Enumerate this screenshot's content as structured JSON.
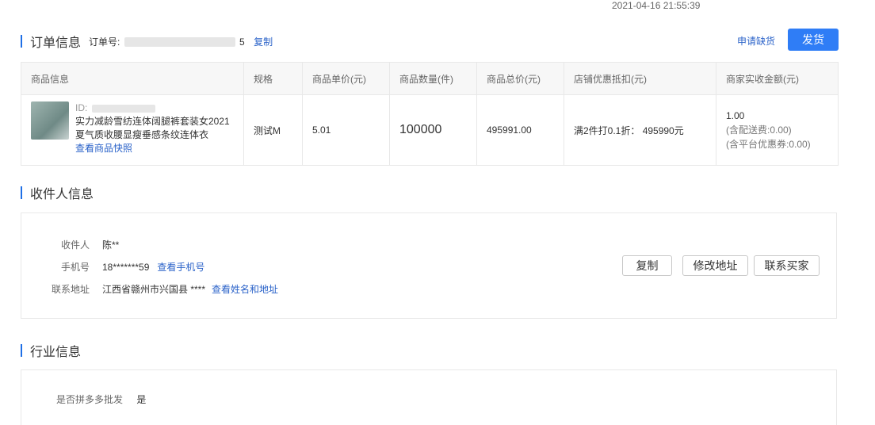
{
  "timestamp": "2021-04-16 21:55:39",
  "order": {
    "section_title": "订单信息",
    "order_no_label": "订单号:",
    "order_no_suffix": "5",
    "copy_link": "复制",
    "apply_shortage": "申请缺货",
    "ship_button": "发货"
  },
  "table": {
    "headers": [
      "商品信息",
      "规格",
      "商品单价(元)",
      "商品数量(件)",
      "商品总价(元)",
      "店铺优惠抵扣(元)",
      "商家实收金额(元)"
    ],
    "product": {
      "id_label": "ID:",
      "name_line1": "实力减龄雪纺连体阔腿裤套装女2021",
      "name_line2": "夏气质收腰显瘦垂感条纹连体衣",
      "snapshot_link": "查看商品快照"
    },
    "spec": "测试M",
    "unit_price": "5.01",
    "quantity": "100000",
    "total_price": "495991.00",
    "discount": "满2件打0.1折：  495990元",
    "received": "1.00",
    "shipping_fee": "(含配送费:0.00)",
    "platform_coupon": "(含平台优惠券:0.00)"
  },
  "receiver": {
    "section_title": "收件人信息",
    "name_label": "收件人",
    "name_value": "陈**",
    "phone_label": "手机号",
    "phone_value": "18*******59",
    "phone_link": "查看手机号",
    "address_label": "联系地址",
    "address_value": "江西省赣州市兴国县 ****",
    "address_link": "查看姓名和地址",
    "copy_button": "复制",
    "edit_address_button": "修改地址",
    "contact_buyer_button": "联系买家"
  },
  "industry": {
    "section_title": "行业信息",
    "wholesale_label": "是否拼多多批发",
    "wholesale_value": "是"
  },
  "colors": {
    "accent": "#2f7df6",
    "link": "#2b63c9",
    "section_bar": "#1e6fe6"
  }
}
